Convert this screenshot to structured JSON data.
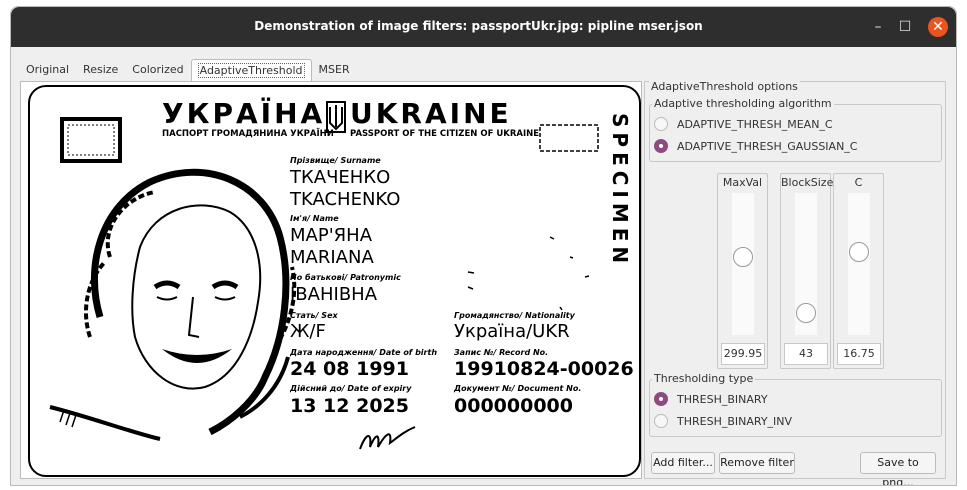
{
  "window": {
    "title": "Demonstration of image filters: passportUkr.jpg: pipline mser.json",
    "controls": {
      "minimize": "–",
      "maximize": "☐",
      "close": "✕"
    }
  },
  "tabs": [
    {
      "label": "Original"
    },
    {
      "label": "Resize"
    },
    {
      "label": "Colorized"
    },
    {
      "label": "AdaptiveThreshold",
      "active": true
    },
    {
      "label": "MSER"
    }
  ],
  "passport": {
    "header_ua": "УКРАЇНА",
    "header_en": "UKRAINE",
    "subheader_ua": "ПАСПОРТ ГРОМАДЯНИНА УКРАЇНИ",
    "subheader_en": "PASSPORT OF THE CITIZEN OF UKRAINE",
    "specimen": "SPECIMEN",
    "surname_label": "Прізвище/ Surname",
    "surname_ua": "ТКАЧЕНКО",
    "surname_en": "TKACHENKO",
    "name_label": "Ім'я/ Name",
    "name_ua": "МАР'ЯНА",
    "name_en": "MARIANA",
    "patronymic_label": "По батькові/ Patronymic",
    "patronymic": "ІВАНІВНА",
    "sex_label": "Стать/ Sex",
    "sex": "Ж/F",
    "nationality_label": "Громадянство/ Nationality",
    "nationality": "Україна/UKR",
    "dob_label": "Дата народження/ Date of birth",
    "dob": "24 08 1991",
    "record_label": "Запис №/ Record No.",
    "record": "19910824-00026",
    "expiry_label": "Дійсний до/ Date of expiry",
    "expiry": "13 12 2025",
    "docno_label": "Документ №/ Document No.",
    "docno": "000000000"
  },
  "panel": {
    "title": "AdaptiveThreshold options",
    "algorithm": {
      "title": "Adaptive thresholding algorithm",
      "options": [
        {
          "label": "ADAPTIVE_THRESH_MEAN_C",
          "selected": false
        },
        {
          "label": "ADAPTIVE_THRESH_GAUSSIAN_C",
          "selected": true
        }
      ]
    },
    "sliders": [
      {
        "label": "MaxVal",
        "value": "299.95",
        "level": 0.56
      },
      {
        "label": "BlockSize",
        "value": "43",
        "level": 0.1
      },
      {
        "label": "C",
        "value": "16.75",
        "level": 0.6
      }
    ],
    "thresholding": {
      "title": "Thresholding type",
      "options": [
        {
          "label": "THRESH_BINARY",
          "selected": true
        },
        {
          "label": "THRESH_BINARY_INV",
          "selected": false
        }
      ]
    },
    "buttons": {
      "add": "Add filter...",
      "remove": "Remove filter",
      "save": "Save to png..."
    }
  },
  "colors": {
    "titlebar": "#2e2e2e",
    "close_button": "#e95420",
    "radio_selected": "#8e4b80",
    "window_bg": "#efefef"
  }
}
